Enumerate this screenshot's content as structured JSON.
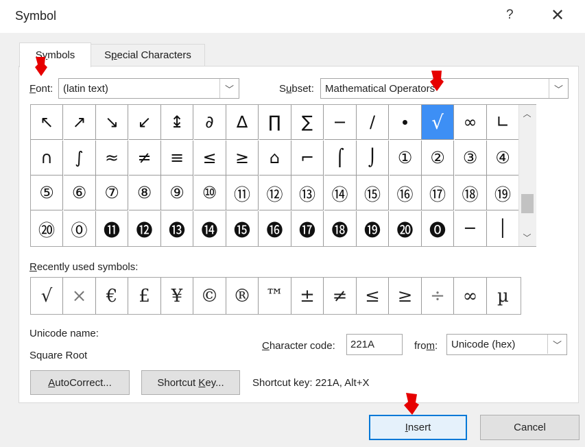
{
  "window": {
    "title": "Symbol",
    "help": "?",
    "close": "✕"
  },
  "tabs": [
    {
      "label": "Symbols",
      "key": "y"
    },
    {
      "label": "Special Characters",
      "key": "p"
    }
  ],
  "font": {
    "label": "Font:",
    "value": "(latin text)"
  },
  "subset": {
    "label": "Subset:",
    "value": "Mathematical Operators"
  },
  "symbols": [
    [
      "↖",
      "↗",
      "↘",
      "↙",
      "↨",
      "∂",
      "∆",
      "∏",
      "∑",
      "−",
      "∕",
      "∙",
      "√",
      "∞",
      "∟"
    ],
    [
      "∩",
      "∫",
      "≈",
      "≠",
      "≡",
      "≤",
      "≥",
      "⌂",
      "⌐",
      "⌠",
      "⌡",
      "①",
      "②",
      "③",
      "④"
    ],
    [
      "⑤",
      "⑥",
      "⑦",
      "⑧",
      "⑨",
      "⑩",
      "⑪",
      "⑫",
      "⑬",
      "⑭",
      "⑮",
      "⑯",
      "⑰",
      "⑱",
      "⑲"
    ],
    [
      "⑳",
      "⓪",
      "⓫",
      "⓬",
      "⓭",
      "⓮",
      "⓯",
      "⓰",
      "⓱",
      "⓲",
      "⓳",
      "⓴",
      "⓿",
      "─",
      "│"
    ]
  ],
  "selected_symbol": "√",
  "recent": {
    "label": "Recently used symbols:",
    "items": [
      "√",
      "×",
      "€",
      "£",
      "¥",
      "©",
      "®",
      "™",
      "±",
      "≠",
      "≤",
      "≥",
      "÷",
      "∞",
      "µ"
    ]
  },
  "unicode_name": {
    "label": "Unicode name:",
    "value": "Square Root"
  },
  "character_code": {
    "label": "Character code:",
    "value": "221A"
  },
  "from": {
    "label": "from:",
    "value": "Unicode (hex)"
  },
  "buttons": {
    "autocorrect": "AutoCorrect...",
    "shortcut_key": "Shortcut Key...",
    "insert": "Insert",
    "cancel": "Cancel"
  },
  "shortcut_info": "Shortcut key: 221A, Alt+X",
  "colors": {
    "selection": "#3d8ff5",
    "annotation": "#e60000",
    "primary_border": "#0078d7"
  }
}
